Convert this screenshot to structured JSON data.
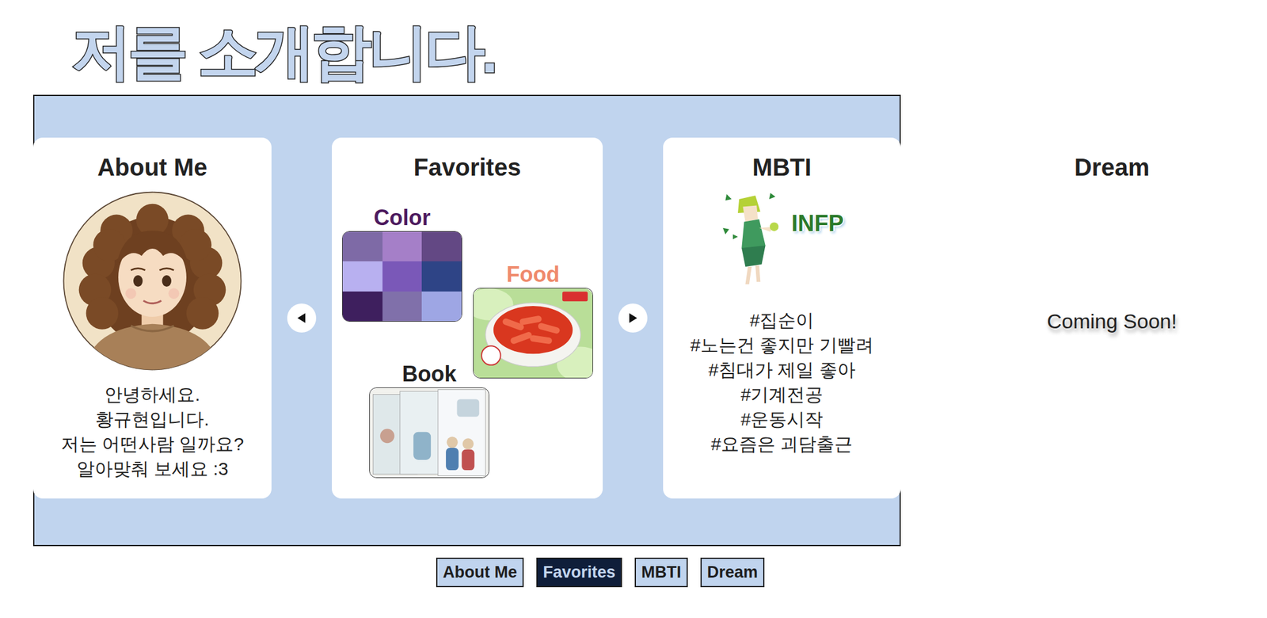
{
  "title": "저를 소개합니다.",
  "cards": [
    {
      "kind": "about",
      "heading": "About Me",
      "lines": [
        "안녕하세요.",
        "황규현입니다.",
        "저는 어떤사람 일까요?",
        "알아맞춰 보세요 :3"
      ]
    },
    {
      "kind": "favorites",
      "heading": "Favorites",
      "items": [
        {
          "label": "Color",
          "color": "#4d1a5e",
          "kind": "swatches",
          "swatches": [
            "#7e6aa6",
            "#a57fc8",
            "#634884",
            "#b8b0f0",
            "#7a58b8",
            "#2e4486",
            "#3e1f5e",
            "#8070aa",
            "#9ea6e4"
          ]
        },
        {
          "label": "Food",
          "color": "#ef8a6c",
          "kind": "food",
          "swatches": []
        },
        {
          "label": "Book",
          "color": "#222222",
          "kind": "book",
          "swatches": []
        }
      ]
    },
    {
      "kind": "mbti",
      "heading": "MBTI",
      "badge": "INFP",
      "lines": [
        "#집순이",
        "#노는건 좋지만 기빨려",
        "#침대가 제일 좋아",
        "#기계전공",
        "#운동시작",
        "#요즘은 괴담출근"
      ]
    },
    {
      "kind": "dream",
      "heading": "Dream",
      "note": "Coming Soon!"
    }
  ],
  "nav": [
    {
      "label": "About Me",
      "selected": false
    },
    {
      "label": "Favorites",
      "selected": true
    },
    {
      "label": "MBTI",
      "selected": false
    },
    {
      "label": "Dream",
      "selected": false
    }
  ]
}
